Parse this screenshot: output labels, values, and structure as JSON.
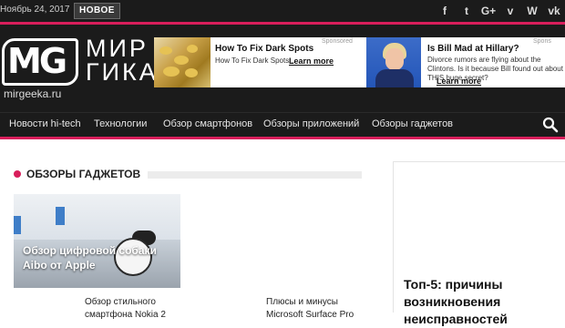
{
  "topbar": {
    "date": "Ноябрь 24, 2017",
    "badge": "НОВОЕ",
    "social": [
      {
        "icon": "facebook-icon",
        "glyph": "f"
      },
      {
        "icon": "twitter-icon",
        "glyph": "t"
      },
      {
        "icon": "google-plus-icon",
        "glyph": "G+"
      },
      {
        "icon": "vimeo-icon",
        "glyph": "v"
      },
      {
        "icon": "wordpress-icon",
        "glyph": "W"
      },
      {
        "icon": "vk-icon",
        "glyph": "vk"
      }
    ]
  },
  "logo": {
    "mark": "MG",
    "title_line1": "МИР",
    "title_line2": "ГИКА",
    "domain": "mirgeeka.ru"
  },
  "ad": {
    "sponsored": "Sponsored",
    "sponsored_right": "Spons",
    "ad1_headline": "How To Fix Dark Spots",
    "ad1_desc": "How To Fix Dark Spots...",
    "ad1_link": "Learn more",
    "ad2_headline": "Is Bill Mad at Hillary?",
    "ad2_desc": "Divorce rumors are flying about the Clintons. Is it because Bill found out about THIS huge secret?",
    "ad2_link": "Learn more"
  },
  "nav": {
    "items": [
      "Новости hi-tech",
      "Технологии",
      "Обзор смартфонов",
      "Обзоры приложений",
      "Обзоры гаджетов"
    ],
    "search_icon": "search-icon"
  },
  "main": {
    "section_title": "ОБЗОРЫ ГАДЖЕТОВ",
    "featured_title": "Обзор цифровой собаки Aibo от Apple",
    "post1_title": "Обзор стильного смартфона Nokia 2",
    "post2_title": "Плюсы и минусы Microsoft Surface Pro"
  },
  "sidebar": {
    "title": "Топ-5: причины возникновения неисправностей"
  },
  "colors": {
    "accent": "#d81e5b",
    "dark": "#1b1b1b"
  }
}
